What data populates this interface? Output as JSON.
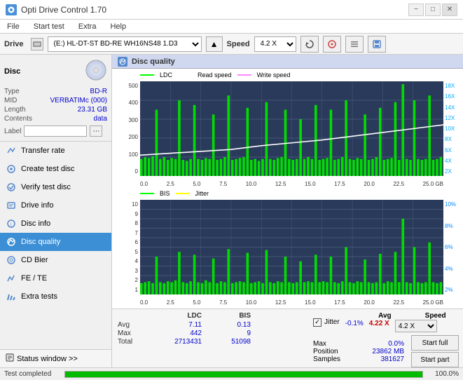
{
  "titlebar": {
    "title": "Opti Drive Control 1.70",
    "minimize": "−",
    "maximize": "□",
    "close": "✕"
  },
  "menubar": {
    "items": [
      "File",
      "Start test",
      "Extra",
      "Help"
    ]
  },
  "drivebar": {
    "label": "Drive",
    "drive_value": "(E:)  HL-DT-ST BD-RE  WH16NS48 1.D3",
    "speed_label": "Speed",
    "speed_value": "4.2 X"
  },
  "disc": {
    "title": "Disc",
    "type_label": "Type",
    "type_value": "BD-R",
    "mid_label": "MID",
    "mid_value": "VERBATIMc (000)",
    "length_label": "Length",
    "length_value": "23.31 GB",
    "contents_label": "Contents",
    "contents_value": "data",
    "label_label": "Label",
    "label_value": ""
  },
  "nav": {
    "items": [
      {
        "id": "transfer-rate",
        "label": "Transfer rate",
        "active": false
      },
      {
        "id": "create-test-disc",
        "label": "Create test disc",
        "active": false
      },
      {
        "id": "verify-test-disc",
        "label": "Verify test disc",
        "active": false
      },
      {
        "id": "drive-info",
        "label": "Drive info",
        "active": false
      },
      {
        "id": "disc-info",
        "label": "Disc info",
        "active": false
      },
      {
        "id": "disc-quality",
        "label": "Disc quality",
        "active": true
      },
      {
        "id": "cd-bier",
        "label": "CD Bier",
        "active": false
      },
      {
        "id": "fe-te",
        "label": "FE / TE",
        "active": false
      },
      {
        "id": "extra-tests",
        "label": "Extra tests",
        "active": false
      }
    ],
    "status_window": "Status window >>"
  },
  "disc_quality": {
    "title": "Disc quality",
    "legend": {
      "ldc_label": "LDC",
      "ldc_color": "#00ff00",
      "read_speed_label": "Read speed",
      "read_speed_color": "#ffffff",
      "write_speed_label": "Write speed",
      "write_speed_color": "#ff00ff"
    },
    "chart1": {
      "y_labels": [
        "500",
        "400",
        "300",
        "200",
        "100",
        "0"
      ],
      "y_right_labels": [
        "18X",
        "16X",
        "14X",
        "12X",
        "10X",
        "8X",
        "6X",
        "4X",
        "2X"
      ],
      "x_labels": [
        "0.0",
        "2.5",
        "5.0",
        "7.5",
        "10.0",
        "12.5",
        "15.0",
        "17.5",
        "20.0",
        "22.5",
        "25.0 GB"
      ]
    },
    "chart2": {
      "legend": {
        "bis_label": "BIS",
        "bis_color": "#00ff00",
        "jitter_label": "Jitter",
        "jitter_color": "#ffff00"
      },
      "y_labels": [
        "10",
        "9",
        "8",
        "7",
        "6",
        "5",
        "4",
        "3",
        "2",
        "1"
      ],
      "y_right_labels": [
        "10%",
        "8%",
        "6%",
        "4%",
        "2%"
      ],
      "x_labels": [
        "0.0",
        "2.5",
        "5.0",
        "7.5",
        "10.0",
        "12.5",
        "15.0",
        "17.5",
        "20.0",
        "22.5",
        "25.0 GB"
      ]
    }
  },
  "stats": {
    "headers": [
      "",
      "LDC",
      "BIS",
      "",
      "Jitter",
      "Speed"
    ],
    "avg_label": "Avg",
    "avg_ldc": "7.11",
    "avg_bis": "0.13",
    "avg_jitter": "-0.1%",
    "max_label": "Max",
    "max_ldc": "442",
    "max_bis": "9",
    "max_jitter": "0.0%",
    "total_label": "Total",
    "total_ldc": "2713431",
    "total_bis": "51098",
    "speed_label": "Speed",
    "speed_value": "4.22 X",
    "speed_select": "4.2 X",
    "position_label": "Position",
    "position_value": "23862 MB",
    "samples_label": "Samples",
    "samples_value": "381627",
    "start_full": "Start full",
    "start_part": "Start part",
    "jitter_checked": true,
    "jitter_label": "Jitter"
  },
  "progress": {
    "percent": 100,
    "text": "100.0%",
    "status_text": "Test completed"
  }
}
